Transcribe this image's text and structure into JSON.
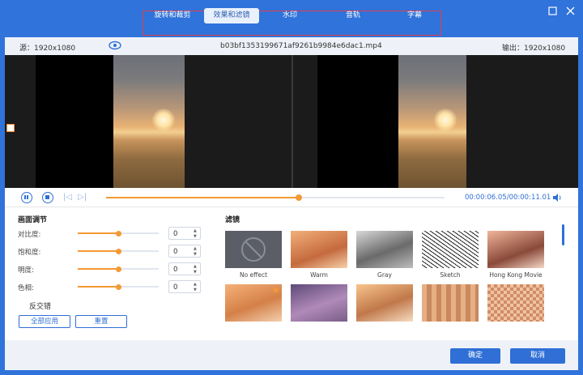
{
  "tabs": [
    {
      "label": "旋转和裁剪",
      "active": false
    },
    {
      "label": "效果和滤镜",
      "active": true
    },
    {
      "label": "水印",
      "active": false
    },
    {
      "label": "音轨",
      "active": false
    },
    {
      "label": "字幕",
      "active": false
    }
  ],
  "window_controls": {
    "maximize_icon": "square-icon",
    "close_icon": "x-icon"
  },
  "info": {
    "source_label": "源：1920x1080",
    "filename": "b03bf1353199671af9261b9984e6dac1.mp4",
    "output_label": "输出：1920x1080"
  },
  "playback": {
    "current": "00:00:06.05",
    "separator": "/",
    "total": "00:00:11.01",
    "progress": 0.57
  },
  "adjust": {
    "title": "画面调节",
    "rows": [
      {
        "label": "对比度:",
        "value": "0",
        "level": 0.5
      },
      {
        "label": "饱和度:",
        "value": "0",
        "level": 0.5
      },
      {
        "label": "明度:",
        "value": "0",
        "level": 0.5
      },
      {
        "label": "色相:",
        "value": "0",
        "level": 0.5
      }
    ],
    "invert_label": "反交错",
    "apply_all_label": "全部应用",
    "reset_label": "重置"
  },
  "filters": {
    "title": "滤镜",
    "items": [
      {
        "label": "No effect",
        "style": "none"
      },
      {
        "label": "Warm",
        "style": "warm"
      },
      {
        "label": "Gray",
        "style": "gray"
      },
      {
        "label": "Sketch",
        "style": "sketch"
      },
      {
        "label": "Hong Kong Movie",
        "style": "hk"
      },
      {
        "label": "",
        "style": "orange",
        "favorite": true
      },
      {
        "label": "",
        "style": "purple"
      },
      {
        "label": "",
        "style": "warm2"
      },
      {
        "label": "",
        "style": "pixel"
      },
      {
        "label": "",
        "style": "mosaic"
      }
    ]
  },
  "footer": {
    "ok_label": "确定",
    "cancel_label": "取消"
  },
  "colors": {
    "accent": "#2f6fd6",
    "slider": "#f39a35",
    "highlight_border": "#e0404a"
  }
}
